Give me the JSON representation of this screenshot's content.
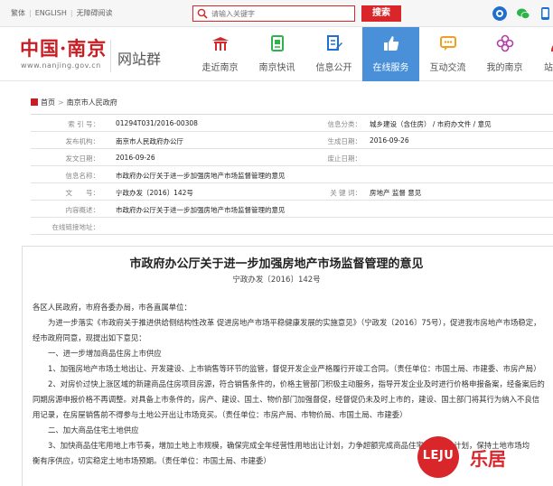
{
  "topbar": {
    "links": [
      "繁体",
      "ENGLISH",
      "无障碍阅读"
    ],
    "search_placeholder": "请输入关键字",
    "search_button": "搜索"
  },
  "header": {
    "logo": "中国·南京",
    "url": "www.nanjing.gov.cn",
    "site_group": "网站群",
    "nav": [
      {
        "label": "走近南京",
        "icon": "gate-icon",
        "active": false
      },
      {
        "label": "南京快讯",
        "icon": "news-icon",
        "active": false
      },
      {
        "label": "信息公开",
        "icon": "document-edit-icon",
        "active": false
      },
      {
        "label": "在线服务",
        "icon": "thumbs-up-icon",
        "active": true
      },
      {
        "label": "互动交流",
        "icon": "chat-icon",
        "active": false
      },
      {
        "label": "我的南京",
        "icon": "flower-icon",
        "active": false
      },
      {
        "label": "站群",
        "icon": "person-icon",
        "active": false
      }
    ]
  },
  "breadcrumb": {
    "home": "首页",
    "separator": ">",
    "current": "南京市人民政府"
  },
  "info": {
    "index_label": "索 引 号：",
    "index_value": "01294T031/2016-00308",
    "category_label": "信息分类：",
    "category_value": "城乡建设（含住房） / 市府办文件 / 意见",
    "issuer_label": "发布机构：",
    "issuer_value": "南京市人民政府办公厅",
    "gen_date_label": "生成日期：",
    "gen_date_value": "2016-09-26",
    "pub_date_label": "发文日期：",
    "pub_date_value": "2016-09-26",
    "expire_label": "废止日期：",
    "expire_value": "",
    "name_label": "信息名称：",
    "name_value": "市政府办公厅关于进一步加强房地产市场监督管理的意见",
    "docnum_label": "文　　号：",
    "docnum_value": "宁政办发〔2016〕142号",
    "keyword_label": "关 键 词：",
    "keyword_value": "房地产 监督 意见",
    "summary_label": "内容概述：",
    "summary_value": "市政府办公厅关于进一步加强房地产市场监督管理的意见",
    "link_label": "在线链接地址：",
    "link_value": ""
  },
  "article": {
    "title": "市政府办公厅关于进一步加强房地产市场监督管理的意见",
    "doc_number": "宁政办发〔2016〕142号",
    "lines": [
      {
        "text": "各区人民政府，市府各委办局，市各直属单位：",
        "indent": false
      },
      {
        "text": "为进一步落实《市政府关于推进供给侧结构性改革 促进房地产市场平稳健康发展的实施意见》（宁政发〔2016〕75号），促进我市房地产市场稳定，",
        "indent": true
      },
      {
        "text": "经市政府同意，现提出如下意见：",
        "indent": false
      },
      {
        "text": "一、进一步增加商品住房上市供应",
        "indent": true
      },
      {
        "text": "1、加强房地产市场土地出让、开发建设、上市销售等环节的监管，督促开发企业严格履行开竣工合同。（责任单位：市国土局、市建委、市房产局）",
        "indent": true
      },
      {
        "text": "2、对房价过快上涨区域的新建商品住房项目房源，符合销售条件的，价格主管部门积极主动服务，指导开发企业及时进行价格申报备案，经备案后的",
        "indent": true
      },
      {
        "text": "同期房源申报价格不再调整。对具备上市条件的，房产、建设、国土、物价部门加强督促，经督促仍未及时上市的，建设、国土部门将其行为纳入不良信",
        "indent": false
      },
      {
        "text": "用记录，在房屋销售前不得参与土地公开出让市场竞买。（责任单位：市房产局、市物价局、市国土局、市建委）",
        "indent": false
      },
      {
        "text": "二、加大商品住宅土地供应",
        "indent": true
      },
      {
        "text": "3、加快商品住宅用地上市节奏，增加土地上市规模，确保完成全年经营性用地出让计划，力争超额完成商品住宅用地出让计划，保持土地市场均",
        "indent": true
      },
      {
        "text": "衡有序供应，切实稳定土地市场预期。（责任单位：市国土局、市建委）",
        "indent": false
      }
    ]
  },
  "watermark": {
    "logo_text": "LEJU",
    "name": "乐居"
  },
  "colors": {
    "brand_red": "#c81d22",
    "search_red": "#d8262a",
    "nav_active": "#4a90d9"
  }
}
